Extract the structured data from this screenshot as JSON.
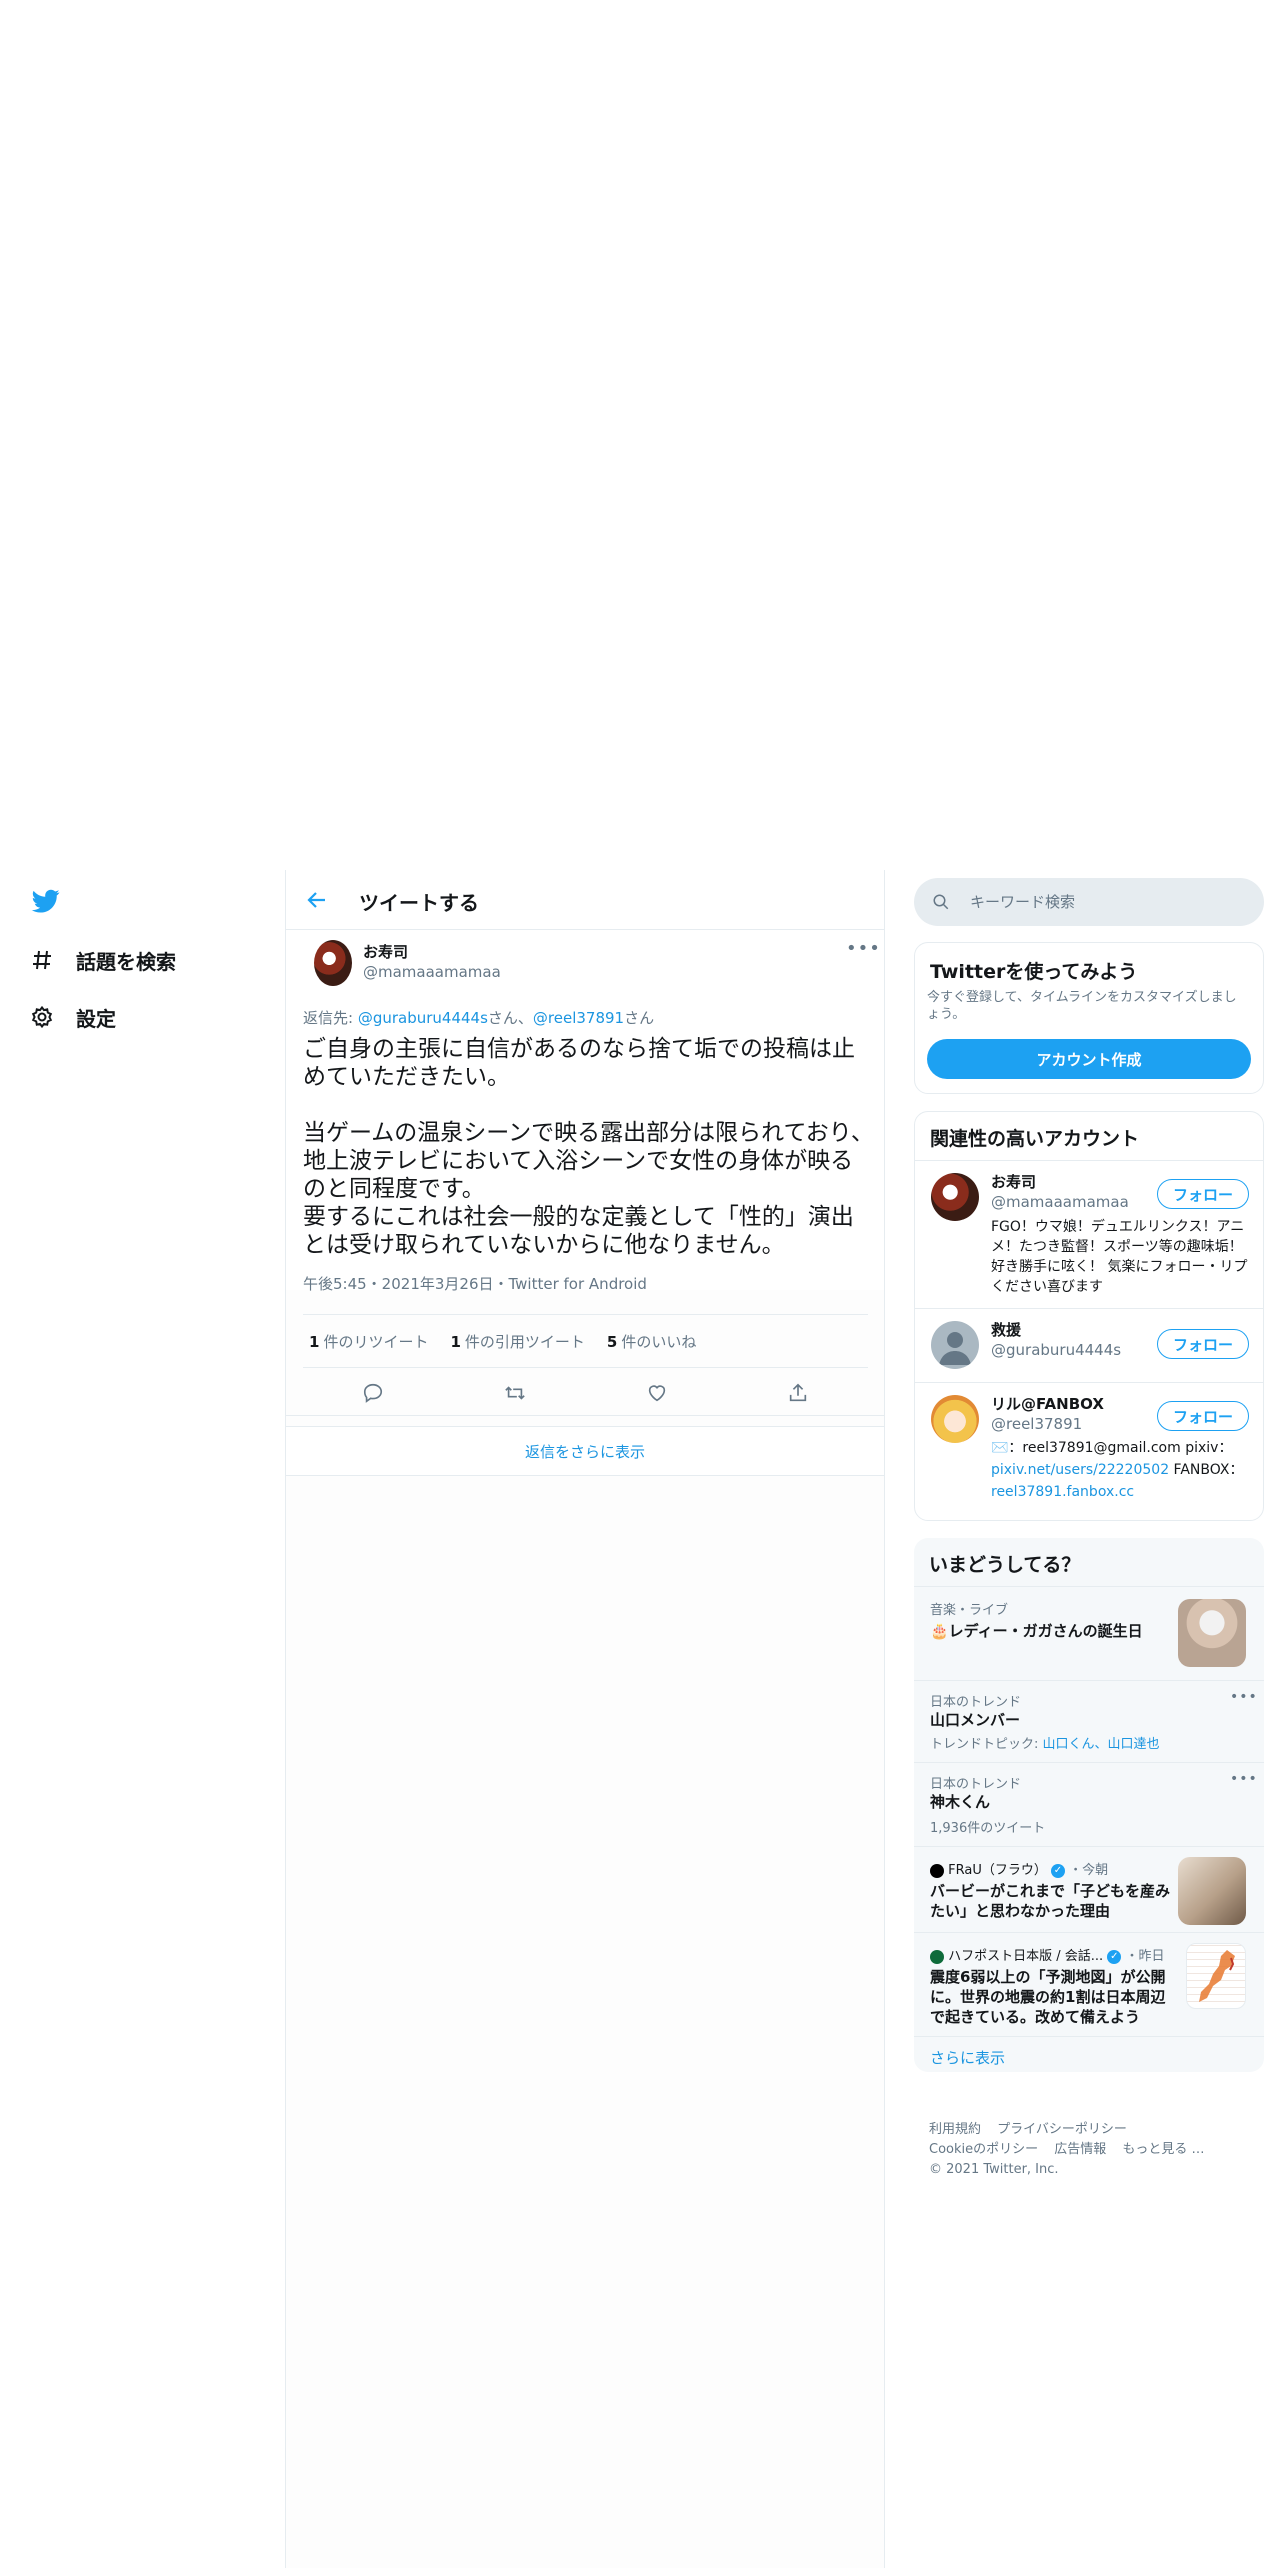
{
  "nav": {
    "logo": "twitter-bird-icon",
    "items": [
      {
        "label": "話題を検索",
        "icon": "hashtag-icon"
      },
      {
        "label": "設定",
        "icon": "gear-icon"
      }
    ]
  },
  "header": {
    "title": "ツイートする"
  },
  "tweet": {
    "name": "お寿司",
    "handle": "@mamaaamamaa",
    "reply_prefix": "返信先: ",
    "reply_user1": "@guraburu4444s",
    "reply_mid": "さん、",
    "reply_user2": "@reel37891",
    "reply_suffix": "さん",
    "text": "ご自身の主張に自信があるのなら捨て垢での投稿は止めていただきたい。\n\n当ゲームの温泉シーンで映る露出部分は限られており、地上波テレビにおいて入浴シーンで女性の身体が映るのと同程度です。\n要するにこれは社会一般的な定義として「性的」演出とは受け取られていないからに他なりません。",
    "meta": "午後5:45・2021年3月26日・Twitter for Android",
    "stats": {
      "retweets_count": "1",
      "retweets_label": "件のリツイート",
      "quotes_count": "1",
      "quotes_label": "件の引用ツイート",
      "likes_count": "5",
      "likes_label": "件のいいね"
    }
  },
  "replies": {
    "show_more": "返信をさらに表示"
  },
  "search": {
    "placeholder": "キーワード検索"
  },
  "signup": {
    "title": "Twitterを使ってみよう",
    "desc": "今すぐ登録して、タイムラインをカスタマイズしましょう。",
    "button": "アカウント作成"
  },
  "relevant": {
    "title": "関連性の高いアカウント",
    "follow_label": "フォロー",
    "users": [
      {
        "name": "お寿司",
        "handle": "@mamaaamamaa",
        "bio": "FGO！ウマ娘！デュエルリンクス！アニメ！たつき監督！スポーツ等の趣味垢！ 好き勝手に呟く！ 気楽にフォロー・リプください喜びます"
      },
      {
        "name": "救援",
        "handle": "@guraburu4444s",
        "bio": ""
      },
      {
        "name": "リル@FANBOX",
        "handle": "@reel37891",
        "bio_prefix": "✉️：reel37891@gmail.com pixiv：",
        "bio_link1": "pixiv.net/users/22220502",
        "bio_mid": " FANBOX：",
        "bio_link2": "reel37891.fanbox.cc"
      }
    ]
  },
  "trends": {
    "title": "いまどうしてる？",
    "items": [
      {
        "category": "音楽・ライブ",
        "name": "🎂レディー・ガガさんの誕生日"
      },
      {
        "category": "日本のトレンド",
        "name": "山口メンバー",
        "sub_prefix": "トレンドトピック: ",
        "sub_link": "山口くん、山口達也"
      },
      {
        "category": "日本のトレンド",
        "name": "神木くん",
        "sub": "1,936件のツイート"
      },
      {
        "source": "FRaU（フラウ）",
        "time": "・今朝",
        "name": "バービーがこれまで「子どもを産みたい」と思わなかった理由"
      },
      {
        "source": "ハフポスト日本版 / 会話...",
        "time": "・昨日",
        "name": "震度6弱以上の「予測地図」が公開に。世界の地震の約1割は日本周辺で起きている。改めて備えよう"
      }
    ],
    "show_more": "さらに表示"
  },
  "footer": {
    "links_row1": [
      "利用規約",
      "プライバシーポリシー"
    ],
    "links_row2": [
      "Cookieのポリシー",
      "広告情報",
      "もっと見る …"
    ],
    "copyright": "© 2021 Twitter, Inc."
  },
  "colors": {
    "accent": "#1da1f2",
    "link": "#1b95e0",
    "muted": "#657786",
    "border": "#e6ecf0"
  }
}
